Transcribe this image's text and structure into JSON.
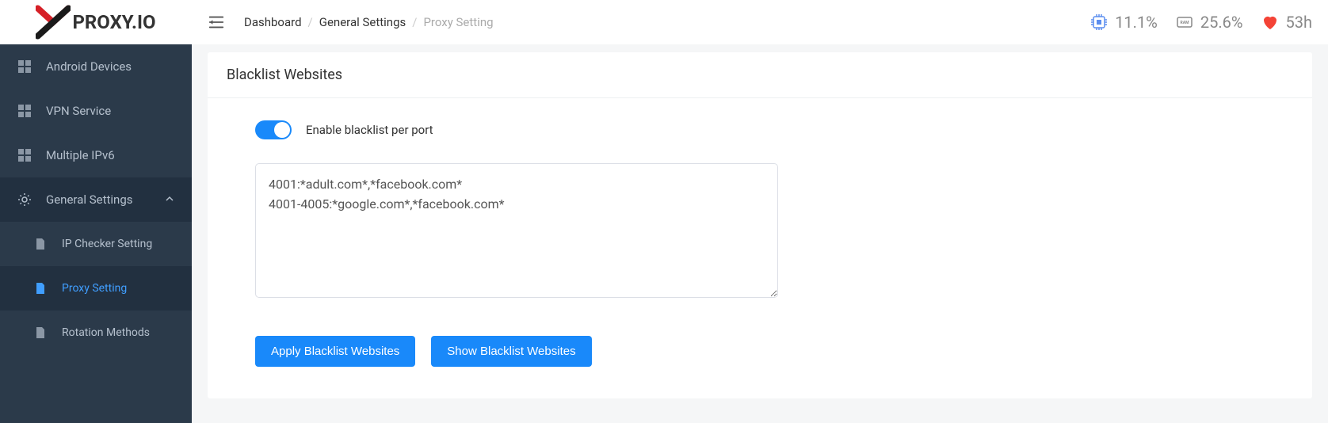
{
  "logo_text": "PROXY.IO",
  "breadcrumb": {
    "root": "Dashboard",
    "parent": "General Settings",
    "current": "Proxy Setting"
  },
  "stats": {
    "cpu": "11.1%",
    "ram": "25.6%",
    "uptime": "53h"
  },
  "sidebar": [
    {
      "id": "android-devices",
      "label": "Android Devices",
      "icon": "grid"
    },
    {
      "id": "vpn-service",
      "label": "VPN Service",
      "icon": "grid"
    },
    {
      "id": "multiple-ipv6",
      "label": "Multiple IPv6",
      "icon": "grid"
    },
    {
      "id": "general-settings",
      "label": "General Settings",
      "icon": "gear",
      "expanded": true
    },
    {
      "id": "ip-checker",
      "label": "IP Checker Setting",
      "icon": "file",
      "sub": true
    },
    {
      "id": "proxy-setting",
      "label": "Proxy Setting",
      "icon": "file",
      "sub": true,
      "active": true
    },
    {
      "id": "rotation-methods",
      "label": "Rotation Methods",
      "icon": "file",
      "sub": true
    }
  ],
  "panel": {
    "title": "Blacklist Websites",
    "toggle_label": "Enable blacklist per port",
    "toggle_on": true,
    "textarea_value": "4001:*adult.com*,*facebook.com*\n4001-4005:*google.com*,*facebook.com*",
    "apply_btn": "Apply Blacklist Websites",
    "show_btn": "Show Blacklist Websites"
  }
}
